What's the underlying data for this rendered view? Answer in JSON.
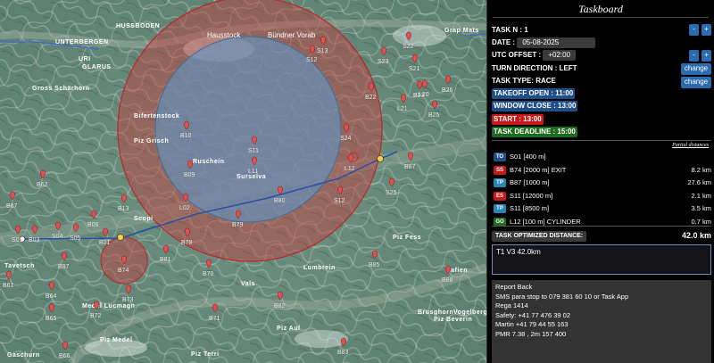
{
  "panel": {
    "title": "Taskboard",
    "task_n": "TASK N : 1",
    "date_label": "DATE :",
    "date_value": "05-08-2025",
    "utc_offset_label": "UTC OFFSET :",
    "utc_offset_value": "+02:00",
    "turn_direction": "TURN DIRECTION : LEFT",
    "task_type": "TASK TYPE: RACE",
    "takeoff_open": "TAKEOFF OPEN : 11:00",
    "window_close": "WINDOW CLOSE : 13:00",
    "start": "START : 13:00",
    "task_deadline": "TASK DEADLINE : 15:00",
    "minus_label": "-",
    "plus_label": "+",
    "change_label": "change",
    "partial_distances": "Partial distances",
    "turnpoints": [
      {
        "type": "TO",
        "name": "S01 [400 m]",
        "dist": ""
      },
      {
        "type": "SS",
        "name": "B74 [2000 m] EXIT",
        "dist": "8.2 km"
      },
      {
        "type": "TP",
        "name": "B87 [1000 m]",
        "dist": "27.6 km"
      },
      {
        "type": "ES",
        "name": "S11 [12000 m]",
        "dist": "2.1 km"
      },
      {
        "type": "TP",
        "name": "S11 [8500 m]",
        "dist": "3.5 km"
      },
      {
        "type": "GO",
        "name": "L12 [100 m] CYLINDER",
        "dist": "0.7 km"
      }
    ],
    "optimized_label": "TASK OPTIMIZED DISTANCE:",
    "optimized_value": "42.0 km",
    "textbox_value": "T1 V3 42.0km",
    "report": [
      "Report Back",
      "SMS  para stop  to  079 381 60 10  or Task App",
      "Rega 1414",
      "Safety: +41 77 476 39 02",
      "Martin +41 79 44 55 163",
      "PMR 7.38 , 2m 157 400"
    ]
  },
  "map": {
    "place_labels": [
      "UNTERBERGEN",
      "HUSSBODEN",
      "URI",
      "GLARUS",
      "Piz Medel",
      "Piz Terri",
      "Piz Aul",
      "Piz Beverin",
      "Piz Fess",
      "Bifertenstock",
      "Piz Grisch",
      "Ruschein",
      "Surselva",
      "Scopi",
      "Brusghorn",
      "Gaschurn",
      "Grap Mats",
      "Vogelberg",
      "Lumbrein",
      "Gross Schärhorn",
      "Tavetsch",
      "Medel Lucmagn",
      "Vals",
      "Safien",
      "Hausstock",
      "Bündner Vorab"
    ],
    "waypoints": [
      "S22",
      "S21",
      "S13",
      "S23",
      "S12",
      "B23",
      "B26",
      "B25",
      "L20",
      "L21",
      "B22",
      "B10",
      "S11",
      "L11",
      "B09",
      "S24",
      "L12",
      "B87",
      "S25",
      "B80",
      "S12",
      "L02",
      "B13",
      "B79",
      "B78",
      "B74",
      "B70",
      "B71",
      "B72",
      "B64",
      "B65",
      "B66",
      "B67",
      "B06",
      "B01",
      "S04",
      "S05",
      "B07",
      "B73",
      "B83",
      "B82",
      "B81",
      "B85",
      "B88",
      "B03",
      "S01",
      "B61",
      "B62"
    ],
    "colors": {
      "outer_cylinder": "#c83a3a",
      "inner_cylinder": "#5e98c8",
      "small_cylinder": "#c83a3a",
      "course_line": "#2a4fa8",
      "pin": "#e05050"
    }
  }
}
